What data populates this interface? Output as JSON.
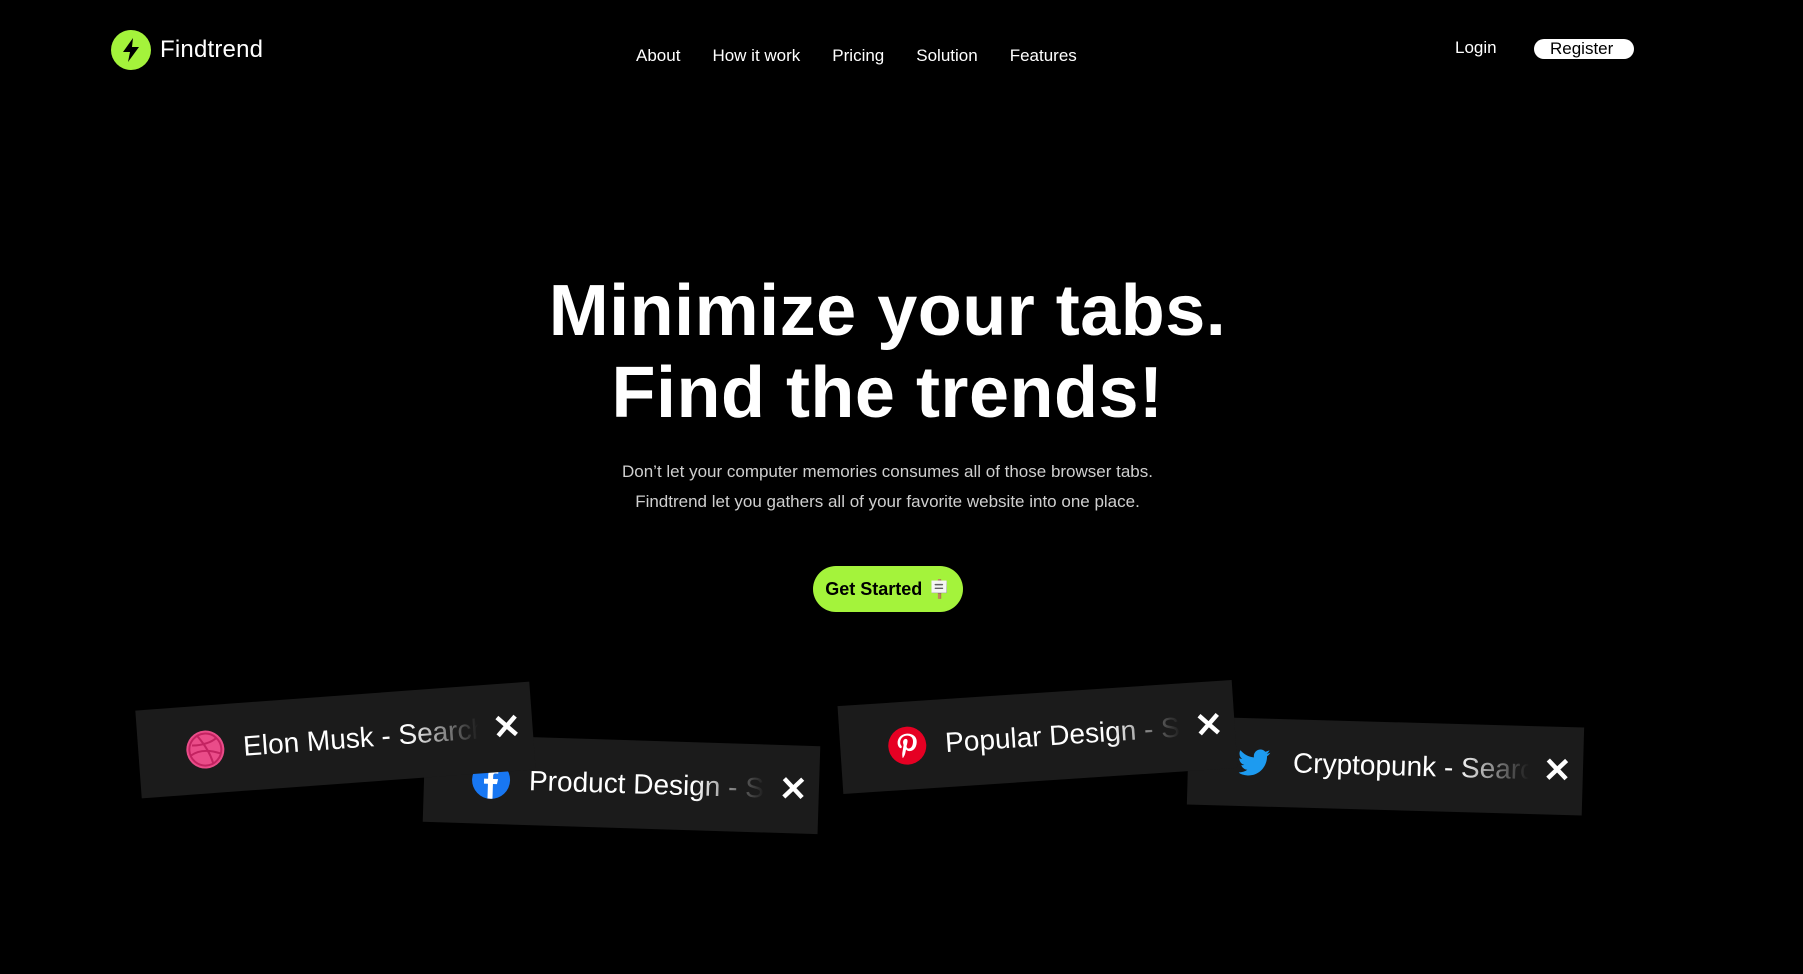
{
  "brand": {
    "name": "Findtrend",
    "icon": "lightning-bolt-icon",
    "accent_color": "#a4f33b"
  },
  "nav": {
    "items": [
      {
        "label": "About"
      },
      {
        "label": "How it work"
      },
      {
        "label": "Pricing"
      },
      {
        "label": "Solution"
      },
      {
        "label": "Features"
      }
    ]
  },
  "auth": {
    "login_label": "Login",
    "register_label": "Register"
  },
  "hero": {
    "title_line1": "Minimize your tabs.",
    "title_line2": "Find the trends!",
    "subtitle_line1": "Don’t let your computer memories consumes all of those browser tabs.",
    "subtitle_line2": "Findtrend let you gathers all of your favorite website into one place.",
    "cta_label": "Get Started",
    "cta_emoji": "🪧"
  },
  "tabs": [
    {
      "label": "Elon Musk - Search",
      "icon": "dribbble-icon",
      "close": "✕"
    },
    {
      "label": "Product Design - Search",
      "icon": "facebook-icon",
      "close": "✕"
    },
    {
      "label": "Popular Design - Search",
      "icon": "pinterest-icon",
      "close": "✕"
    },
    {
      "label": "Cryptopunk - Search",
      "icon": "twitter-icon",
      "close": "✕"
    }
  ]
}
